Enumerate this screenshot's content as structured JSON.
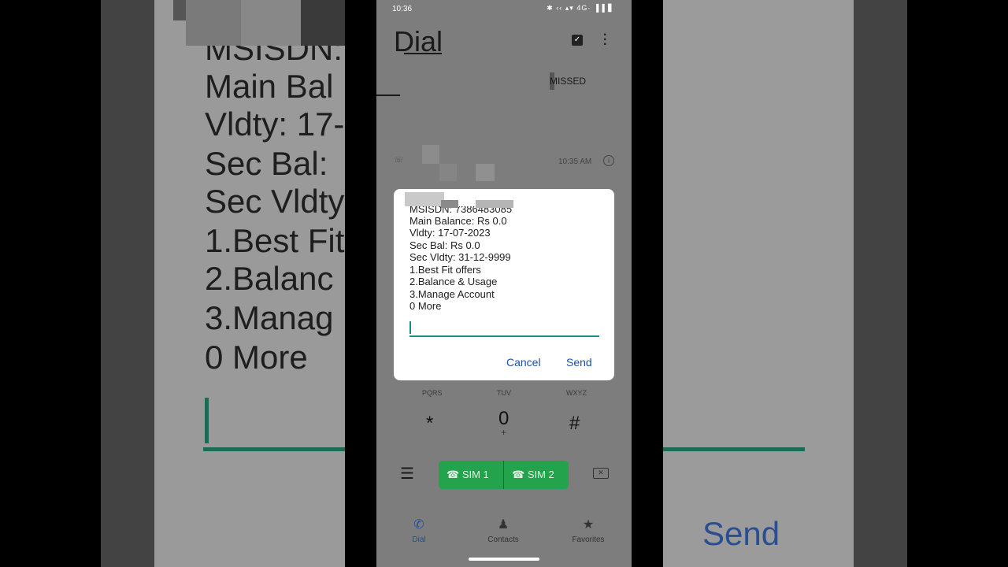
{
  "background": {
    "lines": [
      "MSISDN:",
      "Main Bal",
      "Vldty: 17-",
      "Sec Bal:",
      "Sec Vldty",
      "1.Best Fit",
      "2.Balanc",
      "3.Manag",
      "0 More"
    ],
    "send_label": "Send"
  },
  "status_bar": {
    "time": "10:36",
    "icons": "✱ ‹‹ ▴▾ 4G· ▐▐ ▋"
  },
  "app": {
    "title": "Dial",
    "tab_missed": "MISSED",
    "recent_call_time": "10:35 AM"
  },
  "keypad": {
    "row_letters": [
      "PQRS",
      "TUV",
      "WXYZ"
    ],
    "star": "*",
    "zero": "0",
    "plus": "+",
    "hash": "#"
  },
  "actions": {
    "sim1": "SIM 1",
    "sim2": "SIM 2"
  },
  "bottom_nav": {
    "dial": "Dial",
    "contacts": "Contacts",
    "favorites": "Favorites"
  },
  "dialog": {
    "lines": [
      "MSISDN: 7386483085",
      "Main Balance: Rs 0.0",
      "Vldty: 17-07-2023",
      "Sec Bal: Rs 0.0",
      "Sec Vldty: 31-12-9999",
      "1.Best Fit offers",
      "2.Balance & Usage",
      "3.Manage Account",
      "0 More"
    ],
    "input_value": "",
    "cancel": "Cancel",
    "send": "Send"
  },
  "colors": {
    "accent_blue": "#1d4fa6",
    "sim_green": "#22a34c",
    "input_teal": "#1c8a8a"
  }
}
